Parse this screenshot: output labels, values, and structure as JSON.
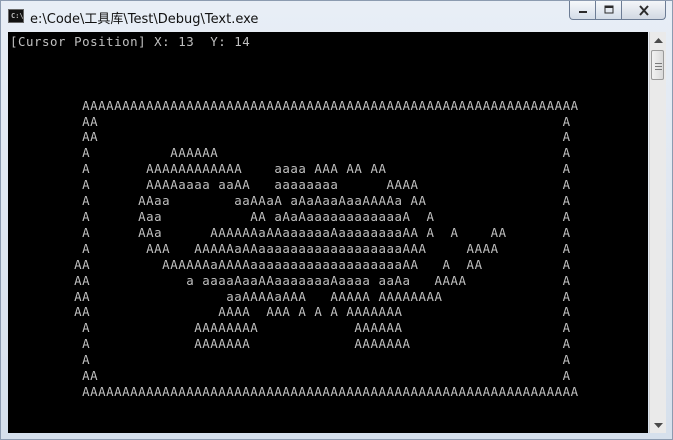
{
  "window": {
    "title": "e:\\Code\\工具库\\Test\\Debug\\Text.exe",
    "icon_name": "console-app-icon",
    "icon_glyph": "C:\\"
  },
  "caption_buttons": {
    "minimize_icon": "minimize-icon",
    "maximize_icon": "maximize-icon",
    "close_icon": "close-icon"
  },
  "console": {
    "status_line": "[Cursor Position] X: 13  Y: 14",
    "lines": [
      "",
      "",
      "",
      "         AAAAAAAAAAAAAAAAAAAAAAAAAAAAAAAAAAAAAAAAAAAAAAAAAAAAAAAAAAAAAA",
      "         AA                                                          A",
      "         AA                                                          A",
      "         A          AAAAAA                                           A",
      "         A       AAAAAAAAAAAA    aaaa AAA AA AA                      A",
      "         A       AAAAaaaa aaAA   aaaaaaaa      AAAA                  A",
      "         A      AAaa        aaAAaA aAaAaaAaaAAAAa AA                 A",
      "         A      Aaa           AA aAaAaaaaaaaaaaaaA  A                A",
      "         A      AAa      AAAAAAaAAaaaaaaAaaaaaaaaAA A  A    AA       A",
      "         A       AAA   AAAAAaAAaaaaaaaaaaaaaaaaaaAAA     AAAA        A",
      "        AA         AAAAAAaAAAAaaaaaaaaaaaaaaaaaaaAA   A  AA          A",
      "        AA            a aaaaAaaAAaaaaaaaAaaaa aaAa   AAAA            A",
      "        AA                 aaAAAAaAAA   AAAAA AAAAAAAA               A",
      "        AA                AAAA  AAA A A A AAAAAAA                    A",
      "         A             AAAAAAAA            AAAAAA                    A",
      "         A             AAAAAAA             AAAAAAA                   A",
      "         A                                                           A",
      "         AA                                                          A",
      "         AAAAAAAAAAAAAAAAAAAAAAAAAAAAAAAAAAAAAAAAAAAAAAAAAAAAAAAAAAAAAA"
    ]
  },
  "scrollbar": {
    "up_icon": "scroll-up-arrow-icon",
    "down_icon": "scroll-down-arrow-icon",
    "position": 0.0
  },
  "colors": {
    "console_bg": "#000000",
    "console_fg": "#c0c0c0"
  }
}
